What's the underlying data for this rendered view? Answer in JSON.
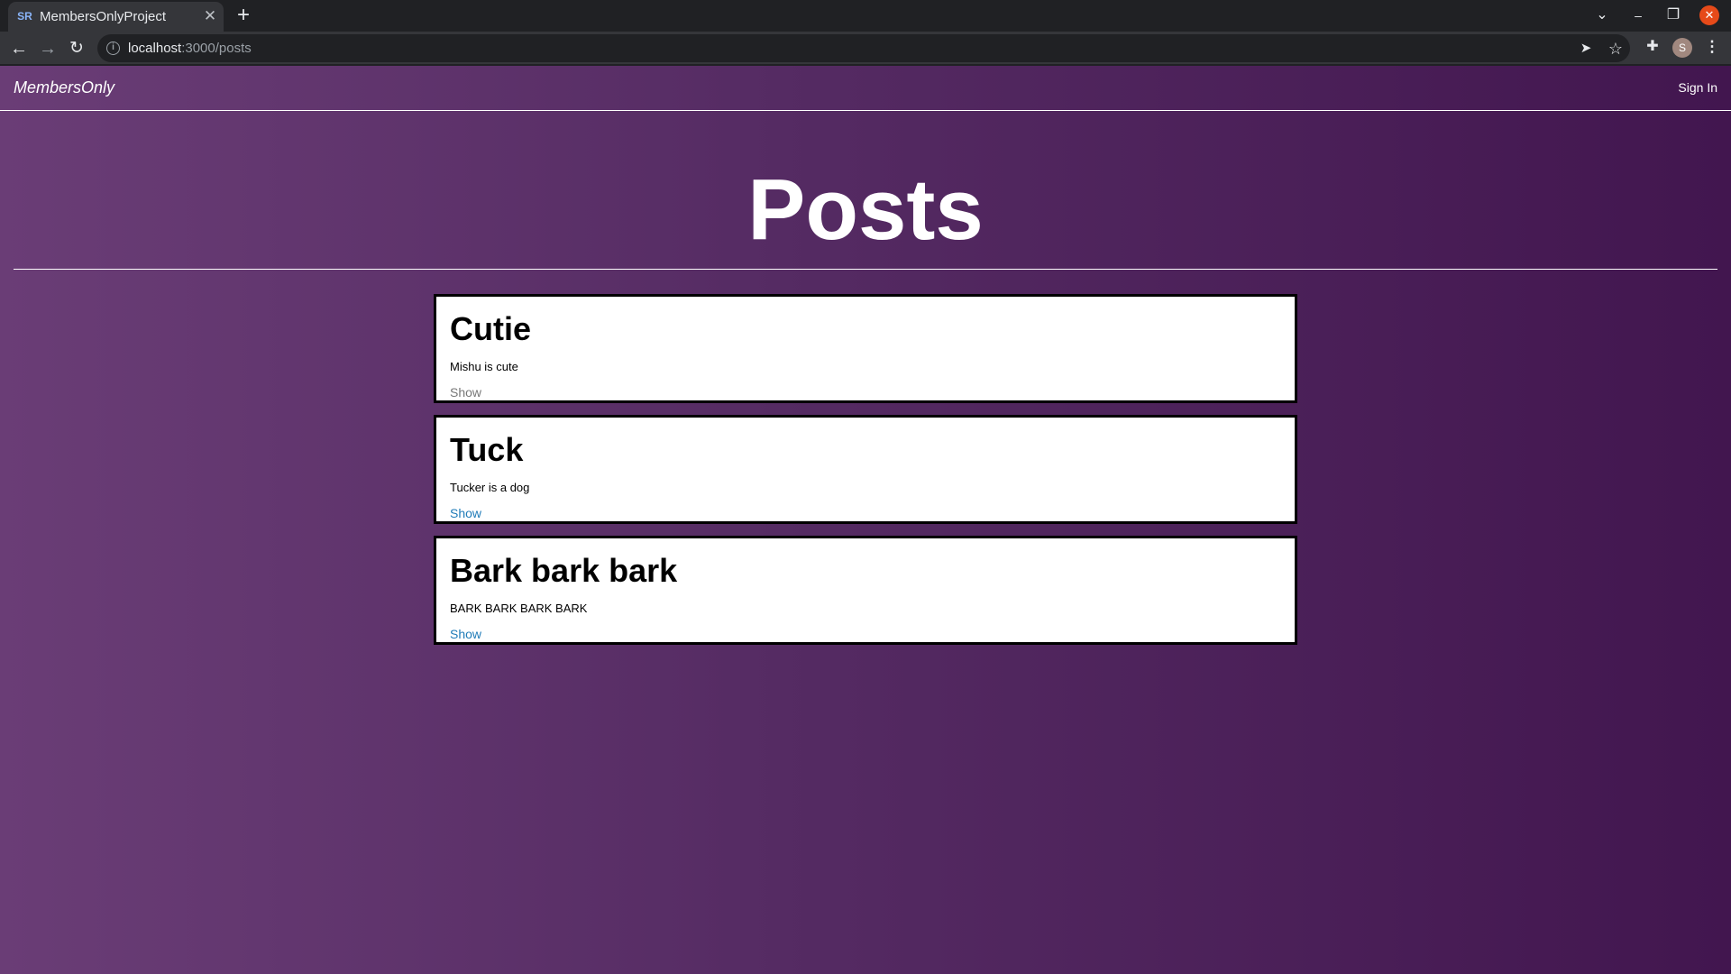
{
  "browser": {
    "tab": {
      "favicon_text": "SR",
      "title": "MembersOnlyProject"
    },
    "url_host": "localhost",
    "url_path": ":3000/posts",
    "profile_initial": "S"
  },
  "site": {
    "brand": "MembersOnly",
    "signin_label": "Sign In"
  },
  "page": {
    "title": "Posts"
  },
  "posts": [
    {
      "title": "Cutie",
      "body": "Mishu is cute",
      "show_label": "Show"
    },
    {
      "title": "Tuck",
      "body": "Tucker is a dog",
      "show_label": "Show"
    },
    {
      "title": "Bark bark bark",
      "body": "BARK BARK BARK BARK",
      "show_label": "Show"
    }
  ],
  "colors": {
    "link": "#1f7bb8",
    "link_visited_hover": "#777777",
    "background_left": "#6a3d76",
    "background_right": "#42164f"
  }
}
